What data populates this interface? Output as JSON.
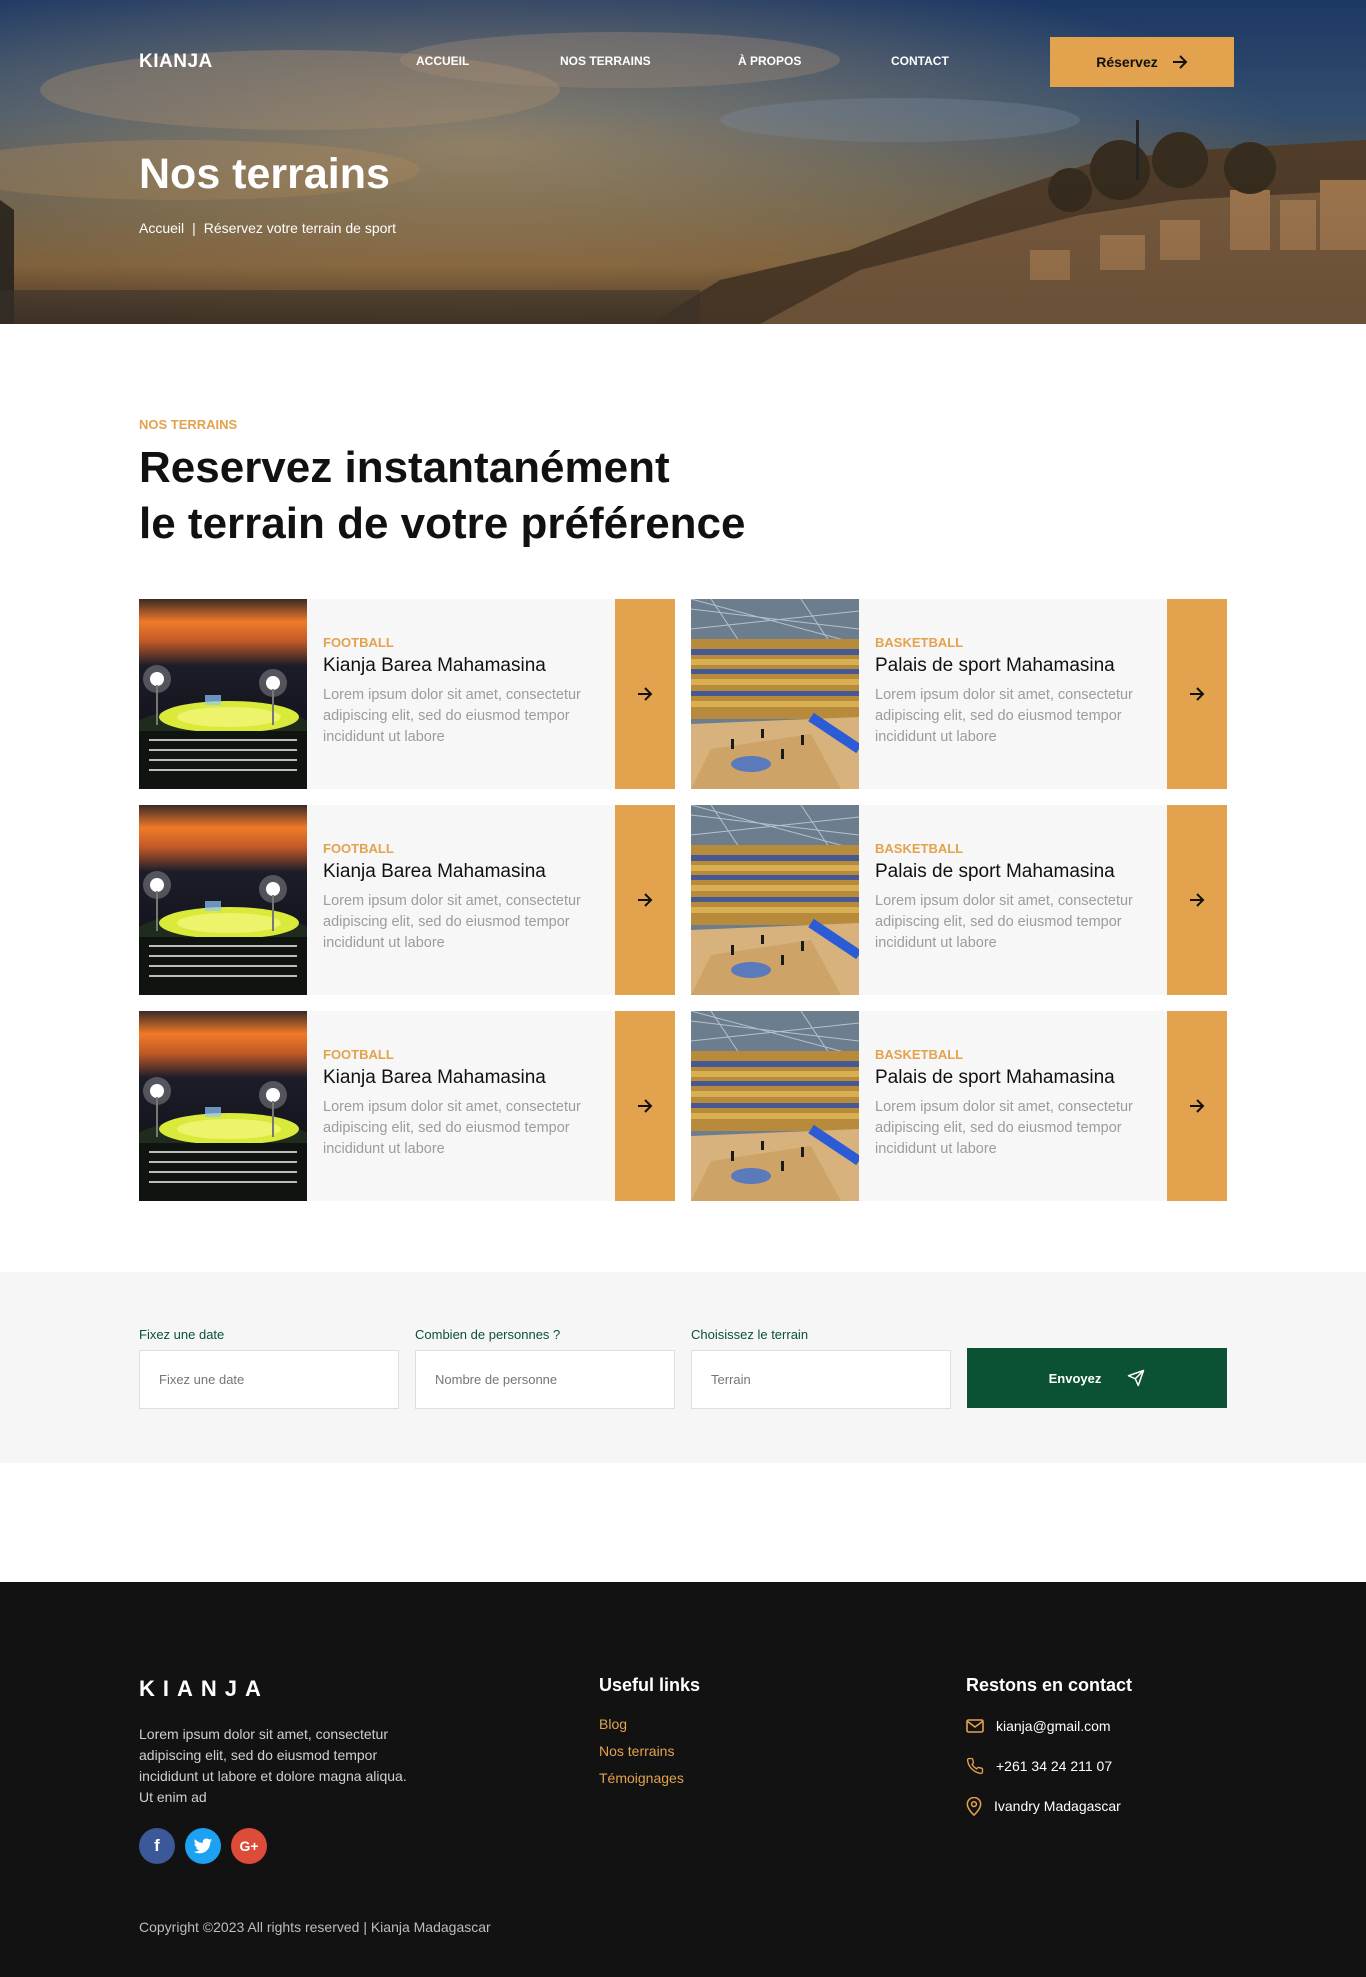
{
  "header": {
    "logo": "KIANJA",
    "nav": [
      "ACCUEIL",
      "NOS TERRAINS",
      "À PROPOS",
      "CONTACT"
    ],
    "reserve_label": "Réservez",
    "title": "Nos terrains",
    "breadcrumb": {
      "home": "Accueil",
      "separator": "|",
      "current": "Réservez votre terrain de sport"
    }
  },
  "section": {
    "eyebrow": "NOS TERRAINS",
    "title_line1": "Reservez instantanément",
    "title_line2": "le terrain de votre préférence"
  },
  "cards": [
    {
      "category": "FOOTBALL",
      "title": "Kianja Barea Mahamasina",
      "description": "Lorem ipsum dolor sit amet, consectetur adipiscing elit, sed do eiusmod tempor incididunt ut labore",
      "image": "stadium"
    },
    {
      "category": "BASKETBALL",
      "title": "Palais de sport Mahamasina",
      "description": "Lorem ipsum dolor sit amet, consectetur adipiscing elit, sed do eiusmod tempor incididunt ut labore",
      "image": "arena"
    },
    {
      "category": "FOOTBALL",
      "title": "Kianja Barea Mahamasina",
      "description": "Lorem ipsum dolor sit amet, consectetur adipiscing elit, sed do eiusmod tempor incididunt ut labore",
      "image": "stadium"
    },
    {
      "category": "BASKETBALL",
      "title": "Palais de sport Mahamasina",
      "description": "Lorem ipsum dolor sit amet, consectetur adipiscing elit, sed do eiusmod tempor incididunt ut labore",
      "image": "arena"
    },
    {
      "category": "FOOTBALL",
      "title": "Kianja Barea Mahamasina",
      "description": "Lorem ipsum dolor sit amet, consectetur adipiscing elit, sed do eiusmod tempor incididunt ut labore",
      "image": "stadium"
    },
    {
      "category": "BASKETBALL",
      "title": "Palais de sport Mahamasina",
      "description": "Lorem ipsum dolor sit amet, consectetur adipiscing elit, sed do eiusmod tempor incididunt ut labore",
      "image": "arena"
    }
  ],
  "booking": {
    "date_label": "Fixez une date",
    "date_placeholder": "Fixez une date",
    "people_label": "Combien de personnes ?",
    "people_placeholder": "Nombre de personne",
    "terrain_label": "Choisissez le terrain",
    "terrain_placeholder": "Terrain",
    "send_label": "Envoyez"
  },
  "footer": {
    "logo": "KIANJA",
    "description": "Lorem ipsum dolor sit amet, consectetur adipiscing elit, sed do eiusmod tempor incididunt ut labore et dolore magna aliqua. Ut enim ad",
    "useful_links_title": "Useful links",
    "links": [
      "Blog",
      "Nos terrains",
      "Témoignages"
    ],
    "contact_title": "Restons en contact",
    "email": "kianja@gmail.com",
    "phone": "+261 34 24 211 07",
    "address": "Ivandry Madagascar",
    "copyright": "Copyright ©2023 All rights reserved | Kianja Madagascar",
    "socials": [
      "facebook-icon",
      "twitter-icon",
      "google-plus-icon"
    ]
  },
  "colors": {
    "accent": "#e3a24d",
    "green": "#0b5134",
    "footer_bg": "#121212"
  }
}
